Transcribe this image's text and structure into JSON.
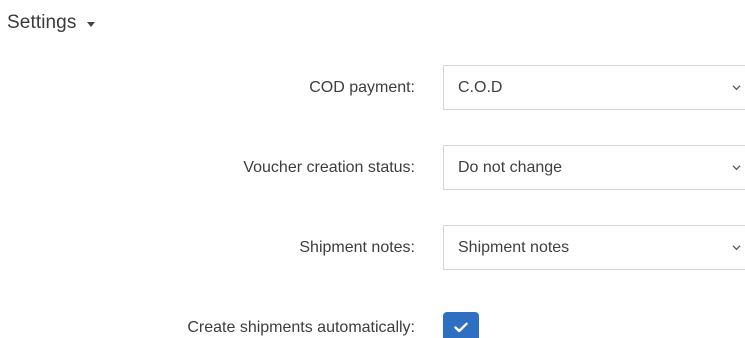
{
  "section": {
    "title": "Settings"
  },
  "fields": [
    {
      "label": "COD payment:",
      "value": "C.O.D"
    },
    {
      "label": "Voucher creation status:",
      "value": "Do not change"
    },
    {
      "label": "Shipment notes:",
      "value": "Shipment notes"
    }
  ],
  "auto_create": {
    "label": "Create shipments automatically:",
    "checked": true
  },
  "colors": {
    "accent": "#2f6fc1",
    "border": "#d6d6d6",
    "text": "#3d3d3d"
  }
}
